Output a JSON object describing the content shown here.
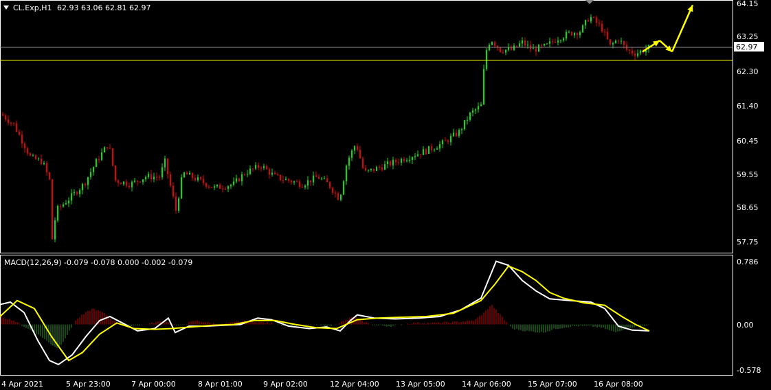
{
  "header": {
    "symbol": "CL.Exp,H1",
    "ohlc": "62.93 63.06 62.81 62.97",
    "collapse_icon": "triangle-down-icon"
  },
  "price_axis": {
    "ticks": [
      "64.15",
      "63.25",
      "62.30",
      "61.40",
      "60.45",
      "59.55",
      "58.65",
      "57.75"
    ],
    "current_price": "62.97"
  },
  "macd_panel": {
    "label": "MACD(12,26,9) -0.079 -0.078 0.000 -0.002 -0.079",
    "ticks": [
      "0.786",
      "0.00",
      "-0.578"
    ]
  },
  "time_axis": {
    "labels": [
      "4 Apr 2021",
      "5 Apr 23:00",
      "7 Apr 00:00",
      "8 Apr 01:00",
      "9 Apr 02:00",
      "12 Apr 04:00",
      "13 Apr 05:00",
      "14 Apr 06:00",
      "15 Apr 07:00",
      "16 Apr 08:00"
    ]
  },
  "colors": {
    "background": "#000000",
    "bull": "#00e600",
    "bear": "#e60000",
    "support_line": "#ffff00",
    "current_price_line": "#9a9a9a",
    "macd_line": "#ffffff",
    "signal_line": "#ffff00",
    "hist_positive": "#cc0000",
    "hist_negative": "#2f8f2f",
    "forecast_arrows": "#ffff00"
  },
  "chart_data": [
    {
      "type": "candlestick",
      "title": "CL.Exp,H1",
      "ylim": [
        57.5,
        64.2
      ],
      "support_level": 62.62,
      "current_price": 62.97,
      "path_points": [
        [
          0,
          61.2
        ],
        [
          20,
          60.9
        ],
        [
          45,
          60.0
        ],
        [
          62,
          59.9
        ],
        [
          72,
          59.4
        ],
        [
          75,
          57.7
        ],
        [
          82,
          58.6
        ],
        [
          100,
          58.9
        ],
        [
          122,
          59.3
        ],
        [
          140,
          59.9
        ],
        [
          158,
          60.4
        ],
        [
          168,
          59.4
        ],
        [
          190,
          59.3
        ],
        [
          212,
          59.5
        ],
        [
          232,
          59.5
        ],
        [
          240,
          59.9
        ],
        [
          256,
          58.6
        ],
        [
          266,
          59.6
        ],
        [
          290,
          59.4
        ],
        [
          312,
          59.2
        ],
        [
          340,
          59.3
        ],
        [
          356,
          59.6
        ],
        [
          380,
          59.8
        ],
        [
          400,
          59.5
        ],
        [
          420,
          59.4
        ],
        [
          440,
          59.3
        ],
        [
          462,
          59.5
        ],
        [
          478,
          59.3
        ],
        [
          494,
          58.9
        ],
        [
          505,
          59.9
        ],
        [
          518,
          60.4
        ],
        [
          530,
          59.6
        ],
        [
          560,
          59.8
        ],
        [
          590,
          60.0
        ],
        [
          620,
          60.2
        ],
        [
          645,
          60.4
        ],
        [
          668,
          60.7
        ],
        [
          685,
          61.2
        ],
        [
          700,
          61.4
        ],
        [
          706,
          62.8
        ],
        [
          714,
          63.2
        ],
        [
          728,
          62.9
        ],
        [
          745,
          62.9
        ],
        [
          760,
          63.1
        ],
        [
          775,
          62.9
        ],
        [
          795,
          63.0
        ],
        [
          810,
          63.2
        ],
        [
          830,
          63.35
        ],
        [
          845,
          63.4
        ],
        [
          858,
          63.8
        ],
        [
          875,
          63.5
        ],
        [
          888,
          63.0
        ],
        [
          900,
          63.2
        ],
        [
          912,
          62.9
        ],
        [
          925,
          62.8
        ],
        [
          945,
          62.97
        ]
      ],
      "forecast_path": [
        [
          935,
          62.85
        ],
        [
          960,
          63.15
        ],
        [
          978,
          62.85
        ],
        [
          1008,
          64.1
        ]
      ]
    },
    {
      "type": "line",
      "title": "MACD(12,26,9)",
      "ylim": [
        -0.578,
        0.786
      ],
      "series": [
        {
          "name": "MACD",
          "points": [
            [
              0,
              0.25
            ],
            [
              15,
              0.28
            ],
            [
              35,
              0.15
            ],
            [
              55,
              -0.2
            ],
            [
              72,
              -0.45
            ],
            [
              85,
              -0.5
            ],
            [
              105,
              -0.38
            ],
            [
              125,
              -0.15
            ],
            [
              145,
              0.05
            ],
            [
              160,
              0.1
            ],
            [
              178,
              0.02
            ],
            [
              200,
              -0.08
            ],
            [
              225,
              -0.05
            ],
            [
              245,
              0.08
            ],
            [
              255,
              -0.1
            ],
            [
              275,
              -0.02
            ],
            [
              300,
              -0.02
            ],
            [
              325,
              -0.01
            ],
            [
              350,
              0.0
            ],
            [
              375,
              0.08
            ],
            [
              395,
              0.06
            ],
            [
              420,
              -0.02
            ],
            [
              450,
              -0.05
            ],
            [
              475,
              -0.03
            ],
            [
              495,
              -0.08
            ],
            [
              510,
              0.05
            ],
            [
              520,
              0.12
            ],
            [
              545,
              0.08
            ],
            [
              575,
              0.07
            ],
            [
              610,
              0.08
            ],
            [
              640,
              0.1
            ],
            [
              670,
              0.18
            ],
            [
              700,
              0.33
            ],
            [
              722,
              0.79
            ],
            [
              740,
              0.74
            ],
            [
              760,
              0.55
            ],
            [
              780,
              0.42
            ],
            [
              800,
              0.32
            ],
            [
              830,
              0.3
            ],
            [
              860,
              0.28
            ],
            [
              880,
              0.2
            ],
            [
              900,
              -0.02
            ],
            [
              920,
              -0.07
            ],
            [
              945,
              -0.08
            ]
          ]
        },
        {
          "name": "Signal",
          "points": [
            [
              0,
              0.1
            ],
            [
              25,
              0.3
            ],
            [
              50,
              0.2
            ],
            [
              75,
              -0.15
            ],
            [
              100,
              -0.45
            ],
            [
              120,
              -0.35
            ],
            [
              145,
              -0.12
            ],
            [
              170,
              0.02
            ],
            [
              195,
              -0.05
            ],
            [
              225,
              -0.06
            ],
            [
              250,
              -0.05
            ],
            [
              280,
              -0.03
            ],
            [
              310,
              -0.01
            ],
            [
              340,
              0.0
            ],
            [
              370,
              0.05
            ],
            [
              400,
              0.05
            ],
            [
              430,
              0.0
            ],
            [
              460,
              -0.04
            ],
            [
              490,
              -0.05
            ],
            [
              520,
              0.06
            ],
            [
              550,
              0.08
            ],
            [
              580,
              0.09
            ],
            [
              620,
              0.1
            ],
            [
              660,
              0.14
            ],
            [
              700,
              0.3
            ],
            [
              720,
              0.5
            ],
            [
              740,
              0.73
            ],
            [
              760,
              0.66
            ],
            [
              780,
              0.55
            ],
            [
              800,
              0.4
            ],
            [
              820,
              0.33
            ],
            [
              850,
              0.27
            ],
            [
              880,
              0.24
            ],
            [
              905,
              0.1
            ],
            [
              925,
              0.0
            ],
            [
              945,
              -0.08
            ]
          ]
        }
      ],
      "histogram": [
        [
          0,
          0.1
        ],
        [
          20,
          0.05
        ],
        [
          40,
          -0.05
        ],
        [
          60,
          -0.15
        ],
        [
          75,
          -0.25
        ],
        [
          85,
          -0.3
        ],
        [
          100,
          -0.1
        ],
        [
          110,
          0.05
        ],
        [
          120,
          0.12
        ],
        [
          135,
          0.2
        ],
        [
          150,
          0.15
        ],
        [
          165,
          0.05
        ],
        [
          180,
          -0.02
        ],
        [
          210,
          0.0
        ],
        [
          240,
          0.05
        ],
        [
          260,
          -0.02
        ],
        [
          285,
          0.05
        ],
        [
          320,
          0.0
        ],
        [
          360,
          0.05
        ],
        [
          390,
          0.02
        ],
        [
          420,
          -0.02
        ],
        [
          450,
          0.0
        ],
        [
          480,
          -0.02
        ],
        [
          500,
          0.04
        ],
        [
          515,
          0.1
        ],
        [
          525,
          0.05
        ],
        [
          545,
          -0.01
        ],
        [
          570,
          -0.02
        ],
        [
          600,
          0.02
        ],
        [
          630,
          0.02
        ],
        [
          660,
          0.03
        ],
        [
          690,
          0.05
        ],
        [
          705,
          0.15
        ],
        [
          715,
          0.25
        ],
        [
          725,
          0.15
        ],
        [
          735,
          0.05
        ],
        [
          745,
          -0.05
        ],
        [
          765,
          -0.08
        ],
        [
          790,
          -0.1
        ],
        [
          810,
          -0.05
        ],
        [
          835,
          -0.02
        ],
        [
          860,
          -0.02
        ],
        [
          880,
          -0.05
        ],
        [
          895,
          -0.1
        ],
        [
          910,
          -0.05
        ],
        [
          930,
          -0.02
        ],
        [
          945,
          0.0
        ]
      ]
    }
  ]
}
